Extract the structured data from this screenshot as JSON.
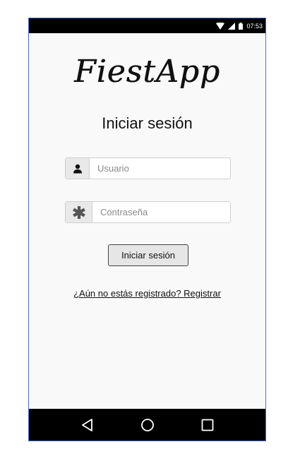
{
  "status_bar": {
    "time": "07:53",
    "icons": [
      "wifi-icon",
      "signal-icon",
      "battery-icon"
    ]
  },
  "app": {
    "logo_text": "FiestApp"
  },
  "login": {
    "title": "Iniciar sesión",
    "username_placeholder": "Usuario",
    "username_value": "",
    "username_icon": "user-icon",
    "password_placeholder": "Contraseña",
    "password_value": "",
    "password_icon": "asterisk-icon",
    "submit_label": "Iniciar sesión",
    "register_link": "¿Aún no estás registrado? Registrar"
  },
  "nav_bar": {
    "buttons": [
      "back-icon",
      "home-icon",
      "recents-icon"
    ]
  },
  "colors": {
    "frame_border": "#4a6fd1",
    "screen_background": "#f9f9f9",
    "system_bars": "#000000"
  }
}
